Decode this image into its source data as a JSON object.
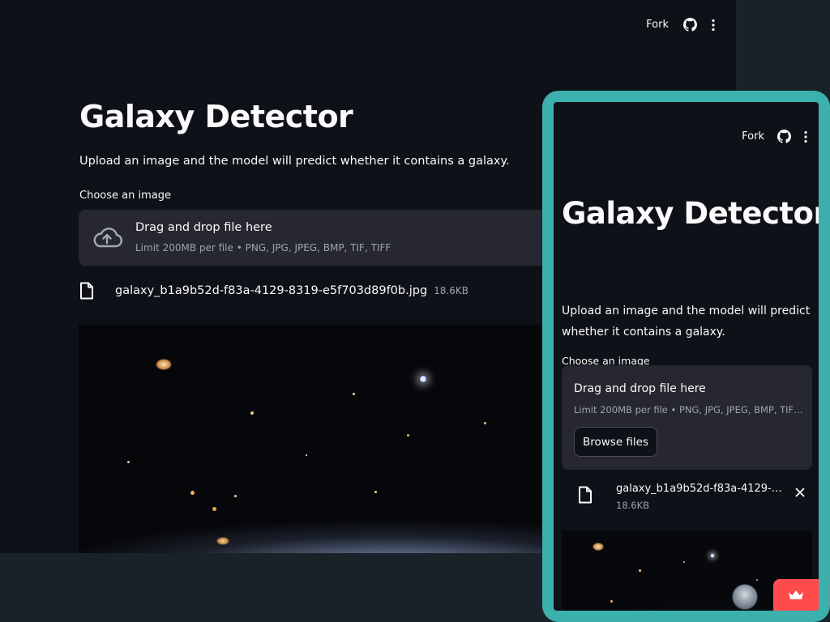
{
  "toolbar": {
    "fork_label": "Fork",
    "icons": [
      "github-icon",
      "kebab-menu-icon"
    ]
  },
  "app": {
    "title": "Galaxy Detector",
    "description": "Upload an image and the model will predict whether it contains a galaxy."
  },
  "uploader": {
    "label": "Choose an image",
    "drop_text": "Drag and drop file here",
    "limit_text": "Limit 200MB per file • PNG, JPG, JPEG, BMP, TIF, TIFF",
    "browse_label": "Browse files",
    "icon": "cloud-upload-icon"
  },
  "uploaded_file": {
    "name": "galaxy_b1a9b52d-f83a-4129-8319-e5f703d89f0b.jpg",
    "size": "18.6KB",
    "icon": "file-icon"
  },
  "colors": {
    "app_background": "#0e1117",
    "page_background": "#182228",
    "panel": "#262730",
    "frame_accent": "#3cb0ad",
    "streamlit_red": "#ff4b4b",
    "muted_text": "#9ea4ad"
  }
}
